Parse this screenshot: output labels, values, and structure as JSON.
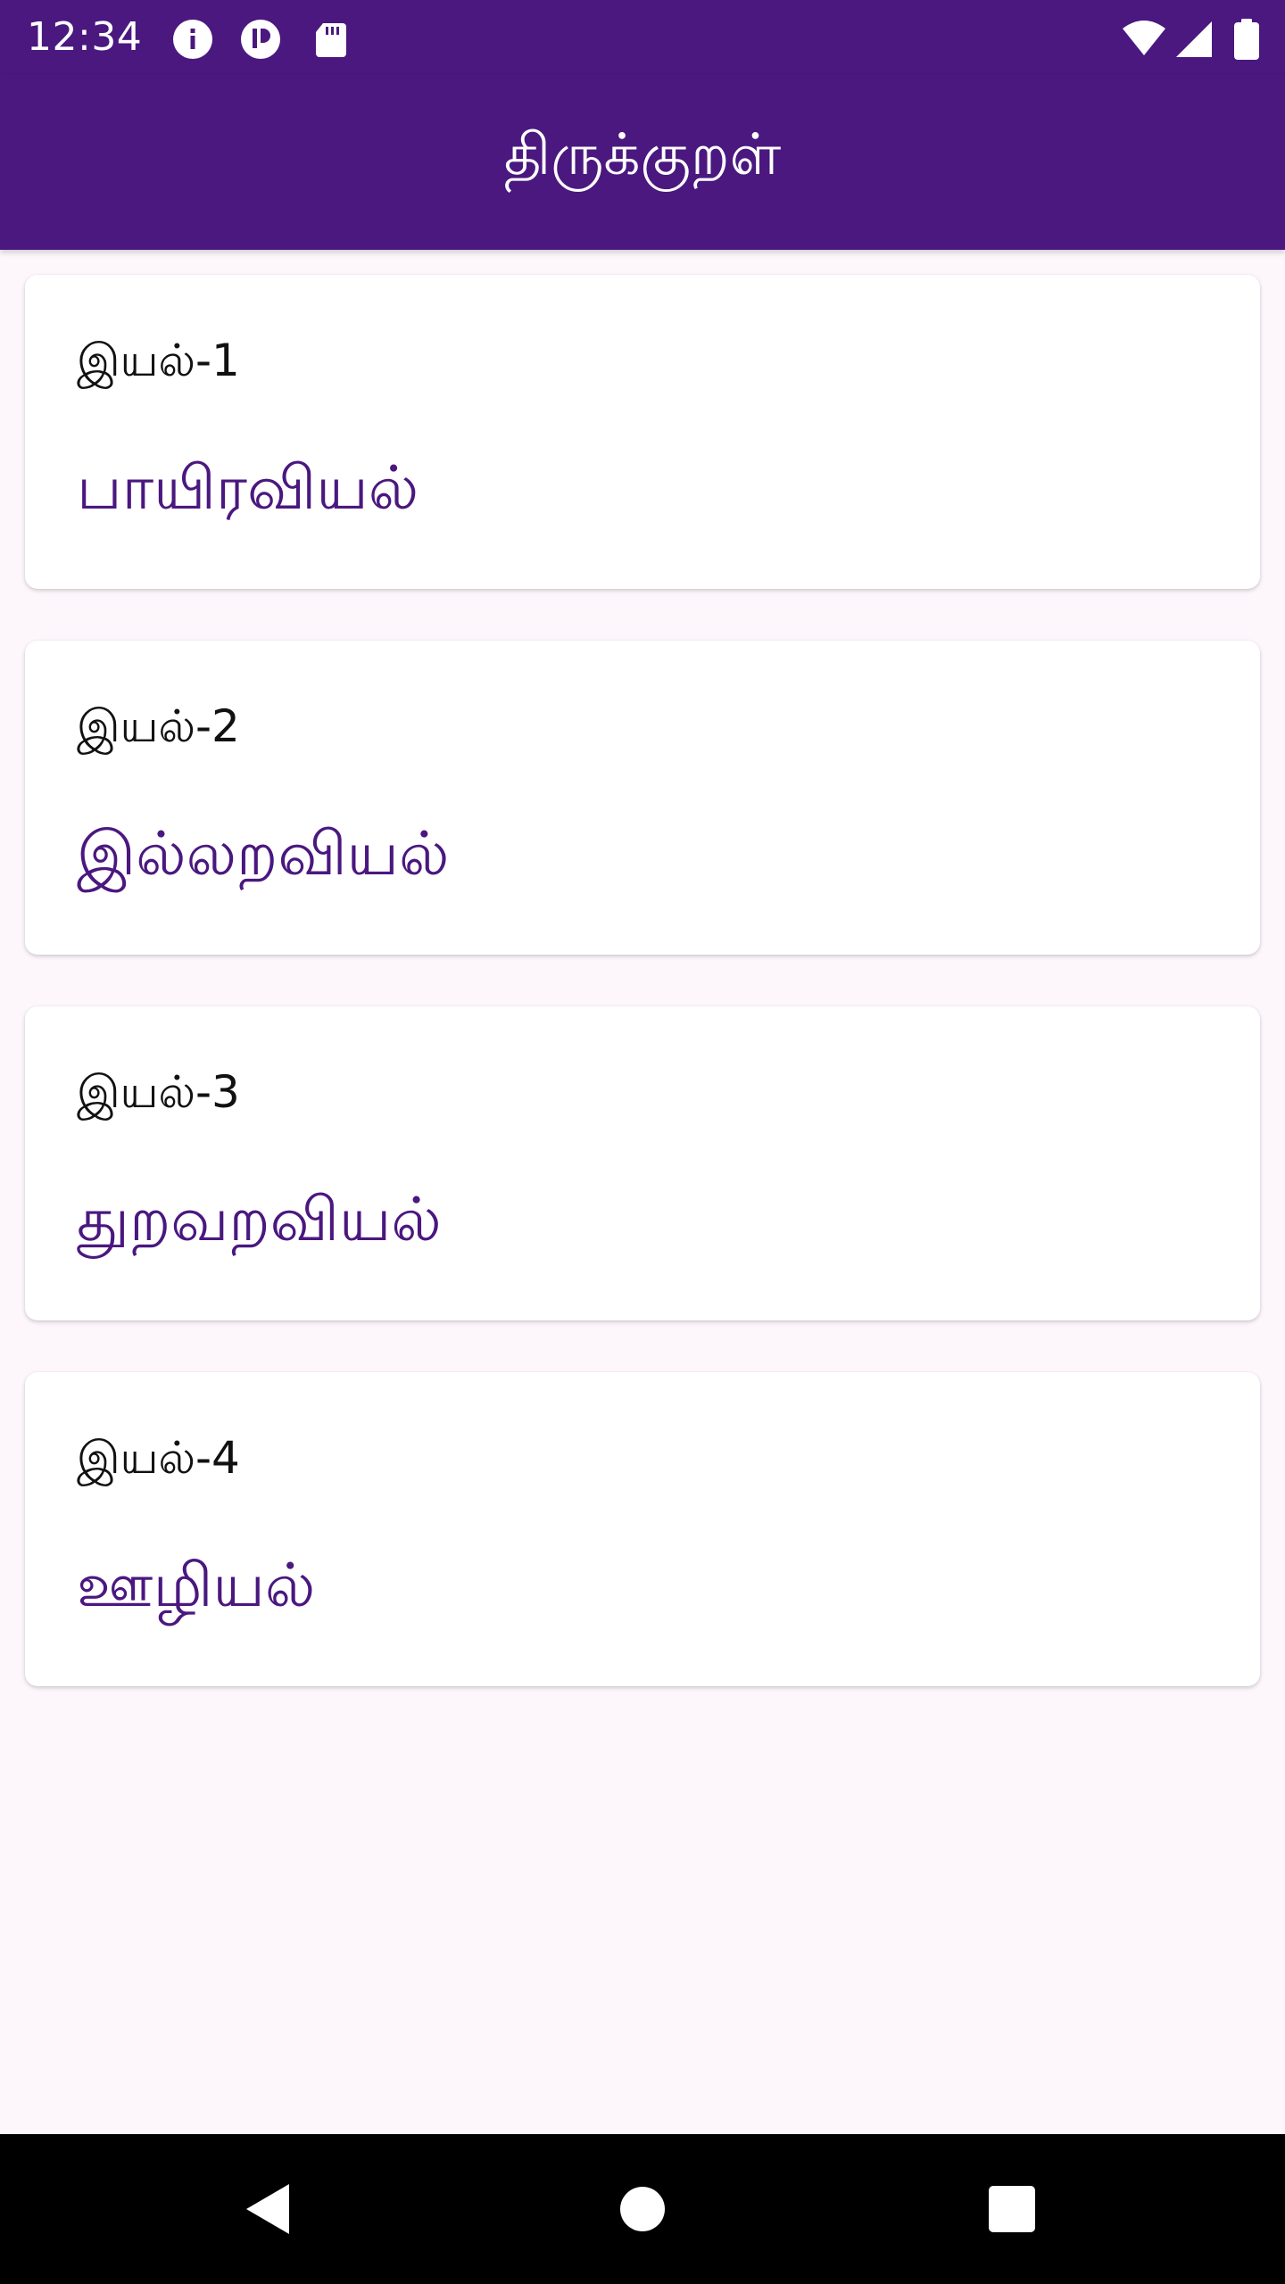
{
  "status_bar": {
    "time": "12:34",
    "icons": [
      "info-icon",
      "notification-icon",
      "sd-card-icon",
      "wifi-icon",
      "signal-icon",
      "battery-icon"
    ],
    "color": "#4a187f"
  },
  "app_bar": {
    "title": "திருக்குறள்",
    "background": "#4a187f"
  },
  "sections": [
    {
      "label": "இயல்-1",
      "title": "பாயிரவியல்"
    },
    {
      "label": "இயல்-2",
      "title": "இல்லறவியல்"
    },
    {
      "label": "இயல்-3",
      "title": "துறவறவியல்"
    },
    {
      "label": "இயல்-4",
      "title": "ஊழியல்"
    }
  ],
  "nav_bar": {
    "buttons": [
      "back-icon",
      "home-icon",
      "recents-icon"
    ]
  },
  "colors": {
    "primary": "#4a187f",
    "background": "#fdf7fc",
    "card": "#ffffff"
  }
}
